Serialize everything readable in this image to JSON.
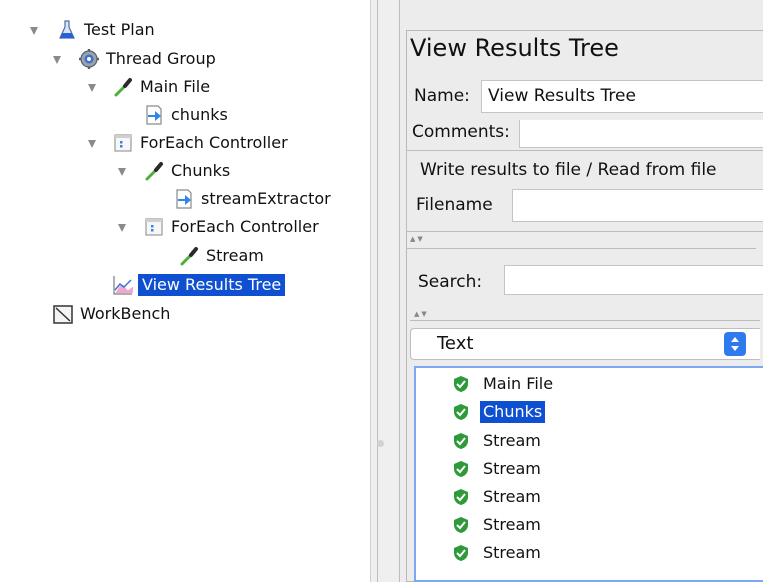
{
  "tree": {
    "items": [
      {
        "label": "Test Plan",
        "icon": "flask-icon"
      },
      {
        "label": "Thread Group",
        "icon": "gear-icon"
      },
      {
        "label": "Main File",
        "icon": "dropper-icon"
      },
      {
        "label": "chunks",
        "icon": "arrow-doc-icon"
      },
      {
        "label": "ForEach Controller",
        "icon": "controller-icon"
      },
      {
        "label": "Chunks",
        "icon": "dropper-icon"
      },
      {
        "label": "streamExtractor",
        "icon": "arrow-doc-icon"
      },
      {
        "label": "ForEach Controller",
        "icon": "controller-icon"
      },
      {
        "label": "Stream",
        "icon": "dropper-icon"
      },
      {
        "label": "View Results Tree",
        "icon": "chart-icon",
        "selected": true
      },
      {
        "label": "WorkBench",
        "icon": "workbench-icon"
      }
    ]
  },
  "panel": {
    "title": "View Results Tree",
    "name_label": "Name:",
    "name_value": "View Results Tree",
    "comments_label": "Comments:",
    "file_group_title": "Write results to file / Read from file",
    "filename_label": "Filename",
    "search_label": "Search:",
    "renderer_value": "Text"
  },
  "results": [
    {
      "label": "Main File",
      "status": "success"
    },
    {
      "label": "Chunks",
      "status": "success",
      "selected": true
    },
    {
      "label": "Stream",
      "status": "success"
    },
    {
      "label": "Stream",
      "status": "success"
    },
    {
      "label": "Stream",
      "status": "success"
    },
    {
      "label": "Stream",
      "status": "success"
    },
    {
      "label": "Stream",
      "status": "success"
    }
  ],
  "colors": {
    "selection": "#0f4fd1",
    "success": "#2e9a3a",
    "dropdown_button": "#2f7bee"
  }
}
